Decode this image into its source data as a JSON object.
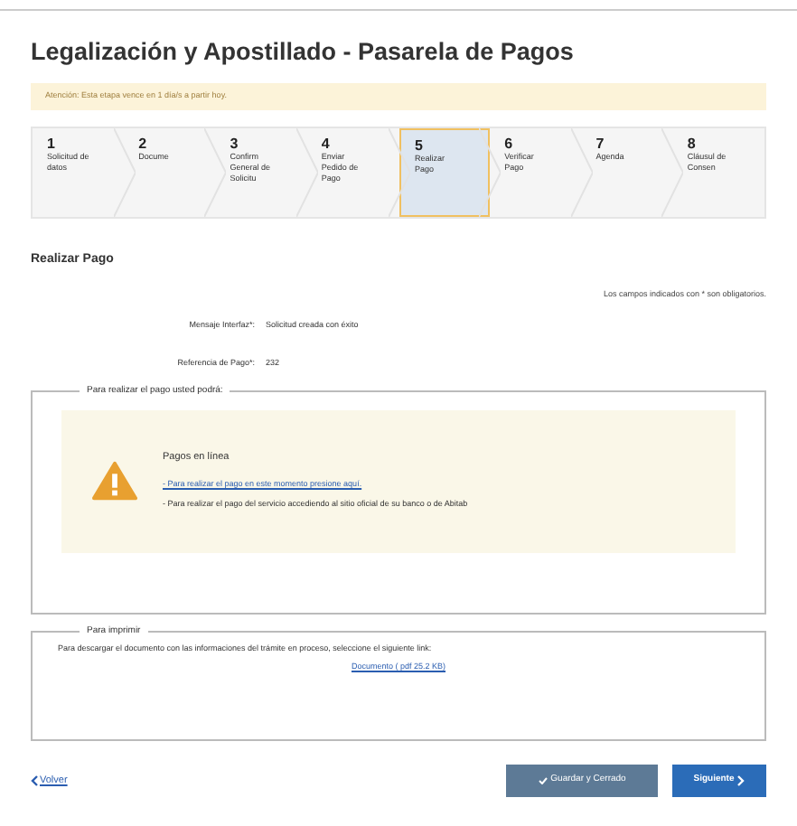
{
  "title": "Legalización y Apostillado - Pasarela de Pagos",
  "alert": "Atención: Esta etapa vence en 1 día/s a partir hoy.",
  "steps": [
    {
      "number": "1",
      "label": "Solicitud de datos",
      "selected": false
    },
    {
      "number": "2",
      "label": "Docume",
      "selected": false
    },
    {
      "number": "3",
      "label": "Confirm General de Solicitu",
      "selected": false
    },
    {
      "number": "4",
      "label": "Enviar Pedido de Pago",
      "selected": false
    },
    {
      "number": "5",
      "label": "Realizar Pago",
      "selected": true
    },
    {
      "number": "6",
      "label": "Verificar Pago",
      "selected": false
    },
    {
      "number": "7",
      "label": "Agenda",
      "selected": false
    },
    {
      "number": "8",
      "label": "Cláusul de Consen",
      "selected": false
    }
  ],
  "section_title": "Realizar Pago",
  "required_note": "Los campos indicados con * son obligatorios.",
  "fields": [
    {
      "label": "Mensaje Interfaz*:",
      "value": "Solicitud creada con éxito"
    },
    {
      "label": "Referencia de Pago*:",
      "value": "232"
    }
  ],
  "payment_box": {
    "legend": "Para realizar el pago usted podrá:",
    "heading": "Pagos en línea",
    "link": "- Para realizar el pago en este momento presione aquí.",
    "text": "- Para realizar el pago del servicio accediendo al sitio oficial de su banco o de Abitab"
  },
  "print_box": {
    "legend": "Para imprimir",
    "text": "Para descargar el documento con las informaciones del trámite en proceso, seleccione el siguiente link:",
    "link": "Documento ( pdf 25.2 KB)"
  },
  "back_link": "Volver",
  "buttons": [
    {
      "kind": "save",
      "label": "Guardar y Cerrado"
    },
    {
      "kind": "next",
      "label": "Siguiente"
    }
  ]
}
